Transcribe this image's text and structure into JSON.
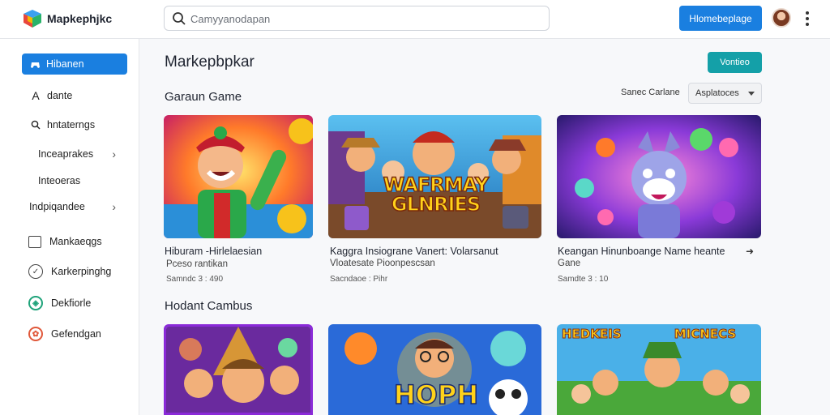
{
  "app": {
    "brand": "Mapkephjkc",
    "primary_button": "Hlomebeplage"
  },
  "search": {
    "placeholder": "Camyyanodapan",
    "value": ""
  },
  "sidebar": {
    "items": [
      {
        "label": "Hibanen",
        "icon": "controller-icon"
      },
      {
        "label": "dante",
        "icon": "text-icon"
      },
      {
        "label": "hntaterngs",
        "icon": "search-icon"
      },
      {
        "label": "Inceaprakes"
      },
      {
        "label": "Inteoeras"
      },
      {
        "label": "Indpiqandee"
      },
      {
        "label": "Mankaeqgs",
        "icon": "window-icon"
      },
      {
        "label": "Karkerpinghg",
        "icon": "check-circle-icon"
      },
      {
        "label": "Dekfiorle",
        "icon": "gift-icon"
      },
      {
        "label": "Gefendgan",
        "icon": "badge-icon"
      }
    ]
  },
  "main": {
    "title": "Markepbpkar",
    "action_button": "Vontieo",
    "section1_title": "Garaun Game",
    "sort_label": "Sanec Carlane",
    "sort_value": "Asplatoces",
    "section2_title": "Hodant Cambus"
  },
  "cards": [
    {
      "title": "Hiburam -Hirlelaesian",
      "subtitle": "Pceso rantikan",
      "meta": "Samndc 3 : 490",
      "art_text": ""
    },
    {
      "title": "Kaggra Insiograne Vanert: Volarsanut",
      "subtitle": "Vloatesate Pioonpescsan",
      "meta": "Sacndaoe : Pihr",
      "art_text": "WAFRMAY GLNRIES"
    },
    {
      "title": "Keangan Hinunboange Name heante",
      "subtitle": "Gane",
      "meta": "Samdte 3 : 10",
      "art_text": ""
    },
    {
      "title": "",
      "subtitle": "",
      "meta": "",
      "art_text": ""
    },
    {
      "title": "",
      "subtitle": "",
      "meta": "",
      "art_text": "HOPH"
    },
    {
      "title": "",
      "subtitle": "",
      "meta": "",
      "art_text": "HEDKEIS MICNECS"
    }
  ],
  "colors": {
    "primary": "#1a7fe0",
    "teal": "#14a0a8"
  }
}
